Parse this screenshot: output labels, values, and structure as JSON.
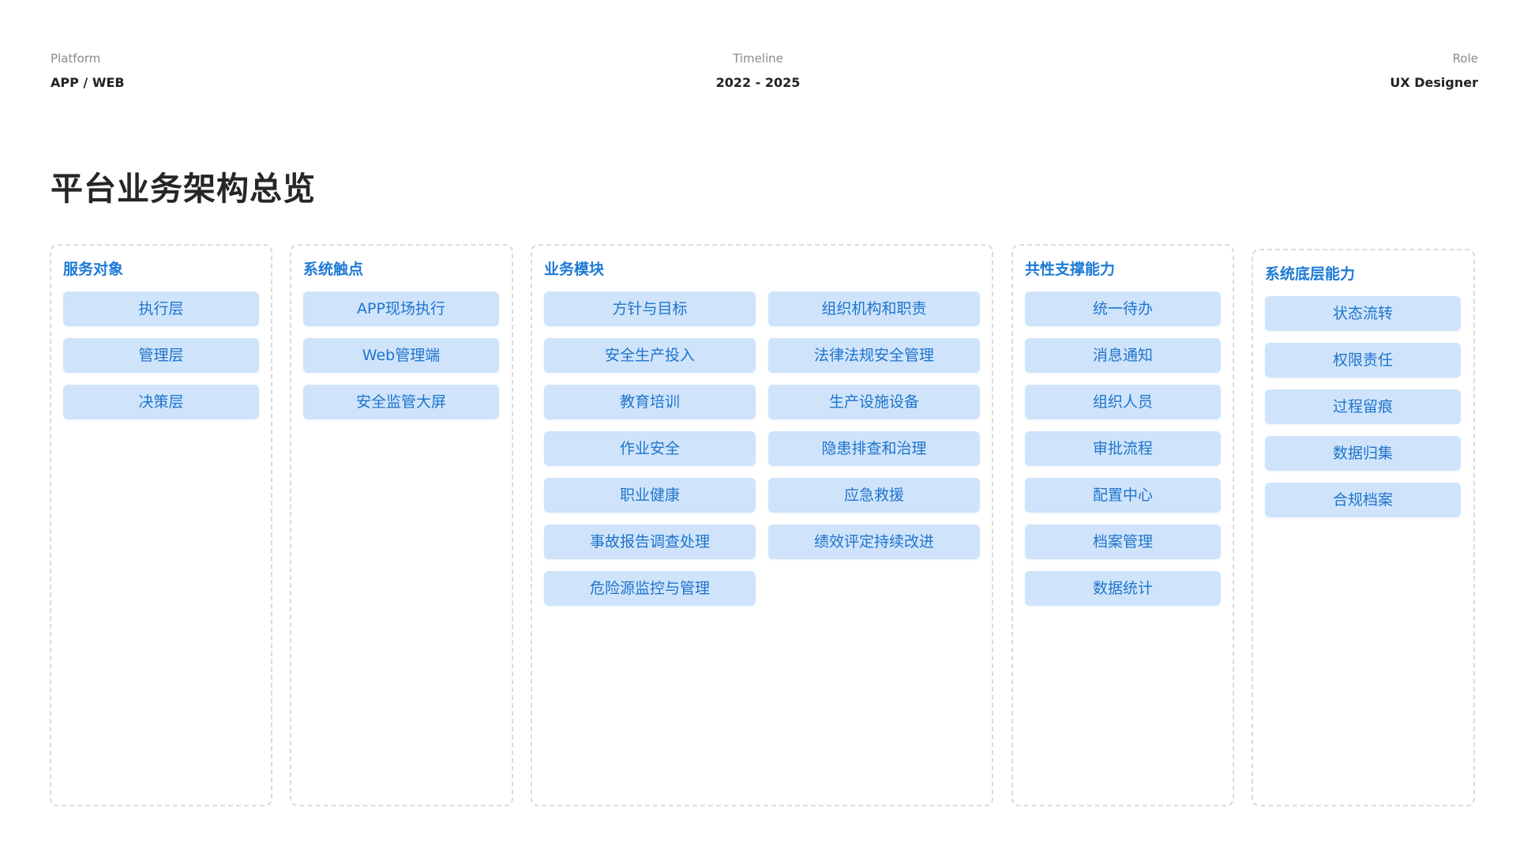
{
  "meta": {
    "platform": {
      "label": "Platform",
      "value": "APP / WEB"
    },
    "timeline": {
      "label": "Timeline",
      "value": "2022 - 2025"
    },
    "role": {
      "label": "Role",
      "value": "UX Designer"
    }
  },
  "title": "平台业务架构总览",
  "colors": {
    "accent": "#1e7ad6",
    "pill_background": "#cfe4fb",
    "pill_text": "#1f74cc",
    "border": "#dadada"
  },
  "columns": [
    {
      "title": "服务对象",
      "items": [
        "执行层",
        "管理层",
        "决策层"
      ]
    },
    {
      "title": "系统触点",
      "items": [
        "APP现场执行",
        "Web管理端",
        "安全监管大屏"
      ]
    },
    {
      "title": "业务模块",
      "items": [
        "方针与目标",
        "组织机构和职责",
        "安全生产投入",
        "法律法规安全管理",
        "教育培训",
        "生产设施设备",
        "作业安全",
        "隐患排查和治理",
        "职业健康",
        "应急救援",
        "事故报告调查处理",
        "绩效评定持续改进",
        "危险源监控与管理"
      ]
    },
    {
      "title": "共性支撑能力",
      "items": [
        "统一待办",
        "消息通知",
        "组织人员",
        "审批流程",
        "配置中心",
        "档案管理",
        "数据统计"
      ]
    },
    {
      "title": "系统底层能力",
      "items": [
        "状态流转",
        "权限责任",
        "过程留痕",
        "数据归集",
        "合规档案"
      ]
    }
  ]
}
